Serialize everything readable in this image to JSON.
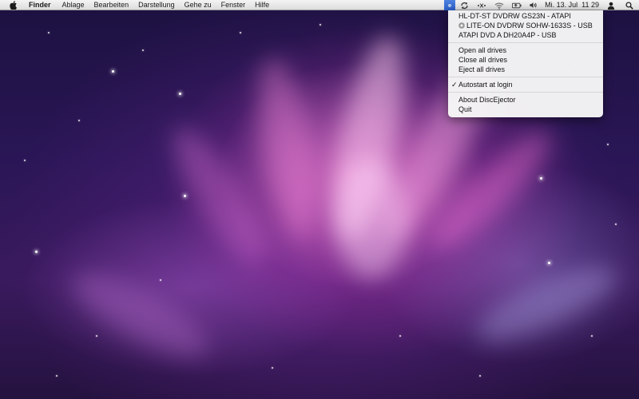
{
  "menubar": {
    "apple_icon": "apple-icon",
    "items": [
      {
        "label": "Finder"
      },
      {
        "label": "Ablage"
      },
      {
        "label": "Bearbeiten"
      },
      {
        "label": "Darstellung"
      },
      {
        "label": "Gehe zu"
      },
      {
        "label": "Fenster"
      },
      {
        "label": "Hilfe"
      }
    ],
    "status": {
      "disc_ejector_icon": "disc-ejector-icon",
      "sync_icon": "sync-icon",
      "bluetooth_icon": "bluetooth-icon",
      "wifi_icon": "wifi-icon",
      "battery_icon": "battery-icon",
      "volume_icon": "volume-icon",
      "clock": "Mi. 13. Jul  11 29",
      "user_icon": "user-icon",
      "spotlight_icon": "spotlight-icon"
    }
  },
  "dropdown": {
    "drives": [
      {
        "label": "HL-DT-ST DVDRW GS23N - ATAPI",
        "has_disc": false
      },
      {
        "label": "LITE-ON DVDRW SOHW-1633S - USB",
        "has_disc": true
      },
      {
        "label": "ATAPI DVD A DH20A4P - USB",
        "has_disc": false
      }
    ],
    "actions": {
      "open_all": "Open all drives",
      "close_all": "Close all drives",
      "eject_all": "Eject all drives"
    },
    "autostart": {
      "label": "Autostart at login",
      "checked": true,
      "check": "✓"
    },
    "about": "About DiscEjector",
    "quit": "Quit"
  },
  "colors": {
    "menubar_active": "#2a5ec4",
    "wallpaper_pink": "#d63cb4",
    "wallpaper_purple": "#2a1656"
  }
}
